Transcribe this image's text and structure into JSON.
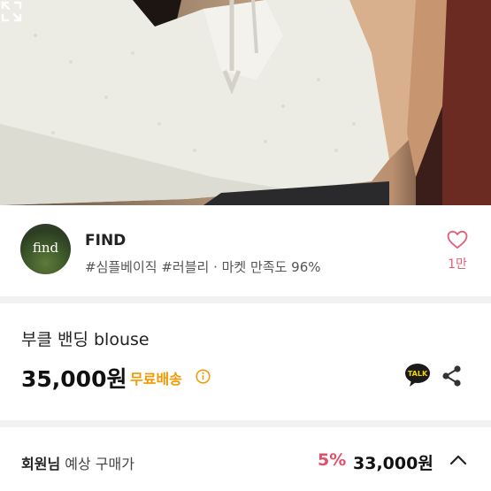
{
  "seller": {
    "avatar_text": "find",
    "name": "FIND",
    "tags": "#심플베이직 #러블리 · 마켓 만족도 96%",
    "likes": "1만"
  },
  "product": {
    "title": "부클 밴딩 blouse",
    "price": "35,000원",
    "shipping": "무료배송",
    "talk_label": "TALK"
  },
  "member_price": {
    "label_bold": "회원님",
    "label_rest": " 예상 구매가",
    "discount": "5%",
    "price": "33,000원"
  },
  "colors": {
    "accent_pink": "#e0506a",
    "shipping_orange": "#f39800",
    "talk_yellow": "#f7d400"
  },
  "icons": [
    "expand-icon",
    "heart-icon",
    "info-icon",
    "kakaotalk-icon",
    "share-icon",
    "chevron-up-icon"
  ]
}
